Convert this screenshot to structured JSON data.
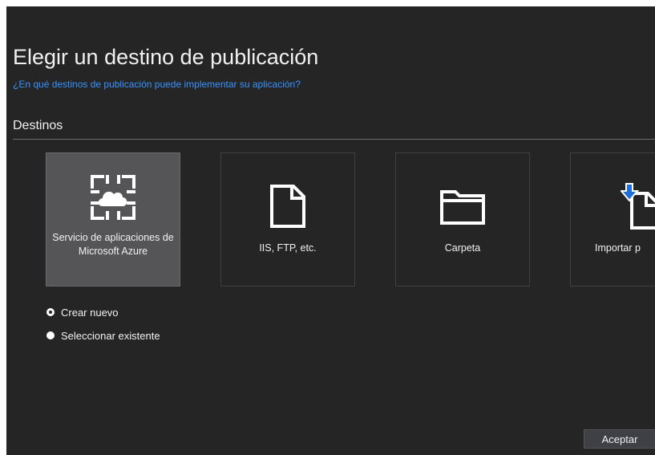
{
  "dialog": {
    "title": "Elegir un destino de publicación",
    "help_link": "¿En qué destinos de publicación puede implementar su aplicación?",
    "section_label": "Destinos"
  },
  "targets": [
    {
      "label": "Servicio de aplicaciones de Microsoft Azure",
      "icon": "azure-app-service-icon",
      "selected": true
    },
    {
      "label": "IIS, FTP, etc.",
      "icon": "document-icon",
      "selected": false
    },
    {
      "label": "Carpeta",
      "icon": "folder-icon",
      "selected": false
    },
    {
      "label": "Importar p",
      "icon": "import-profile-icon",
      "selected": false
    }
  ],
  "options": [
    {
      "label": "Crear nuevo",
      "checked": true
    },
    {
      "label": "Seleccionar existente",
      "checked": false
    }
  ],
  "buttons": {
    "accept": "Aceptar"
  },
  "colors": {
    "background": "#252526",
    "selected_tile": "#555558",
    "link": "#3794ff",
    "import_arrow": "#1e6fd9"
  }
}
